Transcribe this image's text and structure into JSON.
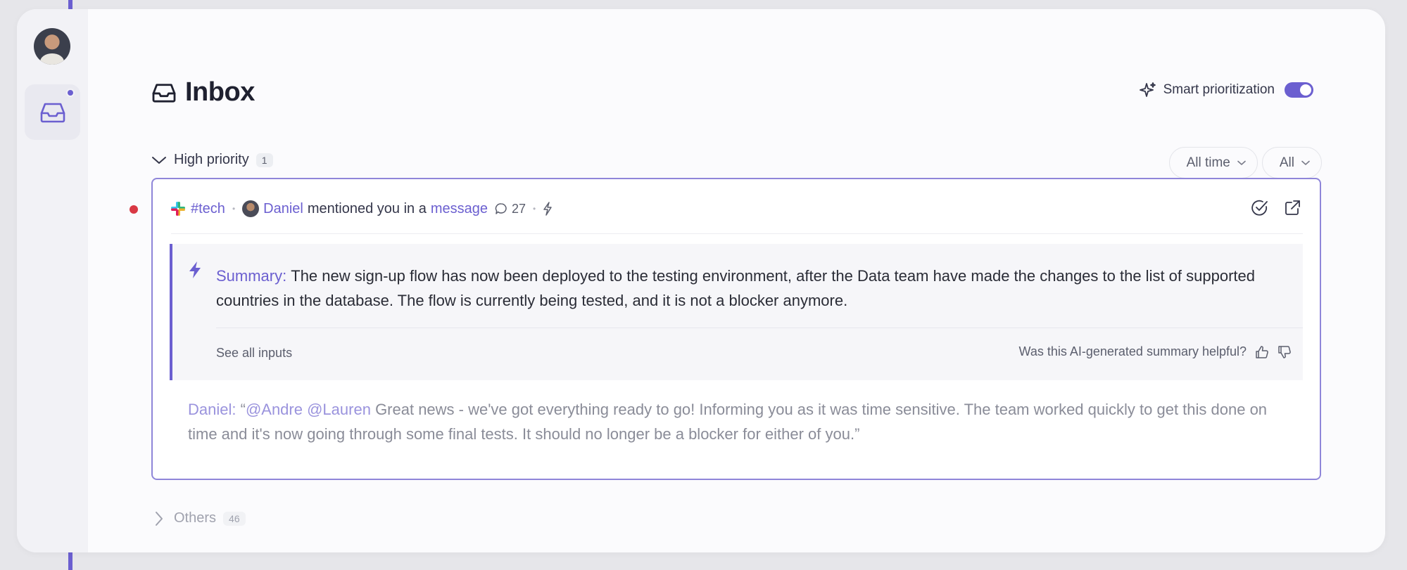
{
  "inbox": {
    "title": "Inbox",
    "smart_prioritization": {
      "label": "Smart prioritization",
      "enabled": true
    }
  },
  "filters": {
    "time": "All time",
    "type": "All"
  },
  "sections": {
    "high": {
      "label": "High priority",
      "count": "1"
    },
    "others": {
      "label": "Others",
      "count": "46"
    }
  },
  "item": {
    "channel": "#tech",
    "sender": "Daniel",
    "text_mid": "mentioned you in a",
    "link": "message",
    "comments": "27",
    "summary": {
      "label": "Summary:",
      "text": "The new sign-up flow has now been deployed to the testing environment, after the Data team have made the changes to the list of supported countries in the database. The flow is currently being tested, and it is not a blocker anymore.",
      "see_all": "See all inputs",
      "feedback": "Was this AI-generated summary helpful?"
    },
    "message": {
      "author": "Daniel:",
      "quote_open": "“",
      "mentions": "@Andre @Lauren",
      "body": "Great news - we've got everything ready to go! Informing you as it was time sensitive. The team worked quickly to get this done on time and it's now going through some final tests. It should no longer be a blocker for either of you.”"
    }
  },
  "colors": {
    "accent": "#6b5fd0",
    "unread": "#d93844"
  }
}
